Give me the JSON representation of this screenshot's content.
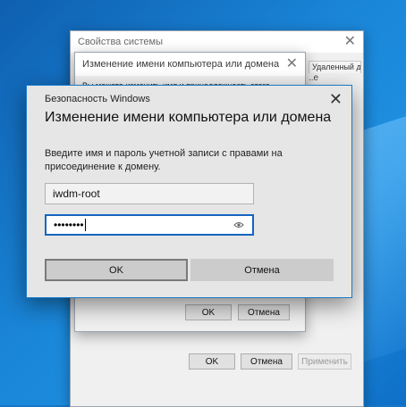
{
  "system_properties": {
    "title": "Свойства системы",
    "close_glyph": "✕",
    "tab_fragment": "Удаленный доступ",
    "tab_dots": "..е",
    "buttons": {
      "ok": "OK",
      "cancel": "Отмена",
      "apply": "Применить"
    }
  },
  "rename_window": {
    "title": "Изменение имени компьютера или домена",
    "close_glyph": "✕",
    "partial_text": "Вы можете изменить имя и принадлежность этого",
    "buttons": {
      "ok": "OK",
      "cancel": "Отмена"
    }
  },
  "security_dialog": {
    "title": "Безопасность Windows",
    "close_glyph": "✕",
    "heading": "Изменение имени компьютера или домена",
    "description": "Введите имя и пароль учетной записи с правами на присоединение к домену.",
    "username_value": "iwdm-root",
    "password_masked": "••••••••",
    "reveal_icon": "eye-icon",
    "buttons": {
      "ok": "OK",
      "cancel": "Отмена"
    }
  },
  "colors": {
    "focus_accent": "#1565c0",
    "dialog_border": "#1979ca",
    "desktop_blue": "#1577c9"
  }
}
